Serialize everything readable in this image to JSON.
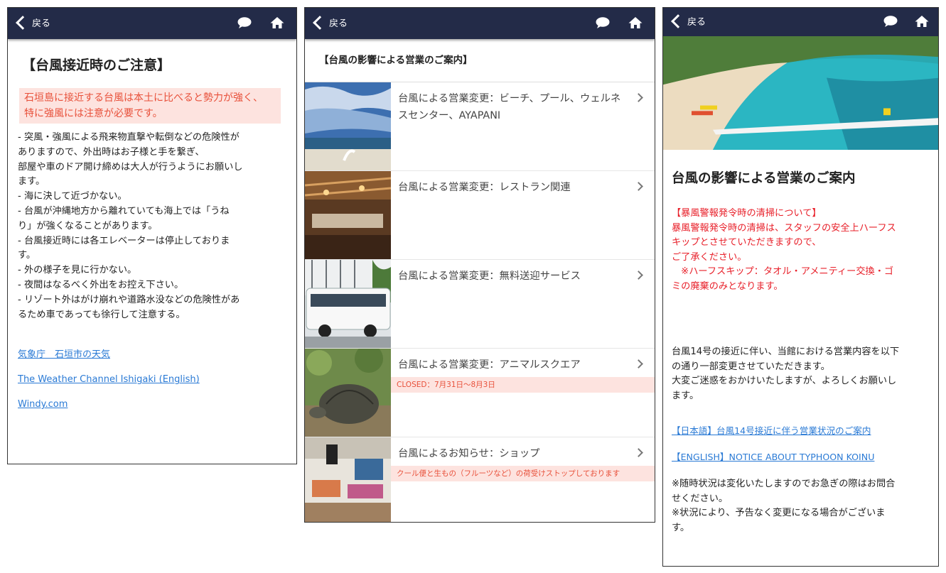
{
  "nav": {
    "back_label": "戻る"
  },
  "panel1": {
    "title": "【台風接近時のご注意】",
    "alert_lines": [
      "石垣島に接近する台風は本土に比べると勢力が強く、",
      "特に強風には注意が必要です。"
    ],
    "body_lines": [
      "- 突風・強風による飛来物直撃や転倒などの危険性が",
      "ありますので、外出時はお子様と手を繋ぎ、",
      "部屋や車のドア開け締めは大人が行うようにお願いし",
      "ます。",
      "- 海に決して近づかない。",
      "- 台風が沖縄地方から離れていても海上では「うね",
      "り」が強くなることがあります。",
      "- 台風接近時には各エレベーターは停止しておりま",
      "す。",
      "- 外の様子を見に行かない。",
      "- 夜間はなるべく外出をお控え下さい。",
      "- リゾート外はがけ崩れや道路水没などの危険性があ",
      "るため車であっても徐行して注意する。"
    ],
    "links": [
      "気象庁　石垣市の天気",
      "The Weather Channel Ishigaki (English)",
      "Windy.com"
    ]
  },
  "panel2": {
    "header": "【台風の影響による営業のご案内】",
    "items": [
      {
        "title": "台風による営業変更：ビーチ、プール、ウェルネスセンター、AYAPANI",
        "note": ""
      },
      {
        "title": "台風による営業変更：レストラン関連",
        "note": ""
      },
      {
        "title": "台風による営業変更：無料送迎サービス",
        "note": ""
      },
      {
        "title": "台風による営業変更：アニマルスクエア",
        "note": "CLOSED：7月31日〜8月3日"
      },
      {
        "title": "台風によるお知らせ：ショップ",
        "note": "クール便と生もの（フルーツなど）の荷受けストップしております"
      }
    ]
  },
  "panel3": {
    "title": "台風の影響による営業のご案内",
    "red_lines": [
      "【暴風警報発令時の清掃について】",
      "暴風警報発令時の清掃は、スタッフの安全上ハーフス",
      "キップとさせていただきますので、",
      "ご了承ください。",
      "　※ハーフスキップ：タオル・アメニティー交換・ゴ",
      "ミの廃棄のみとなります。"
    ],
    "body_lines": [
      "台風14号の接近に伴い、当館における営業内容を以下",
      "の通り一部変更させていただきます。",
      "大変ご迷惑をおかけいたしますが、よろしくお願いし",
      "ます。"
    ],
    "links": [
      "【日本語】台風14号接近に伴う営業状況のご案内",
      "【ENGLISH】NOTICE ABOUT TYPHOON KOINU"
    ],
    "notes": [
      "※随時状況は変化いたしますのでお急ぎの際はお問合",
      "せください。",
      "※状況により、予告なく変更になる場合がございま",
      "す。"
    ]
  },
  "colors": {
    "topbar": "#232b48",
    "alert_bg": "#fde3df",
    "alert_text": "#e8503a",
    "link": "#2a7ad5",
    "red_notice": "#e8202a"
  }
}
